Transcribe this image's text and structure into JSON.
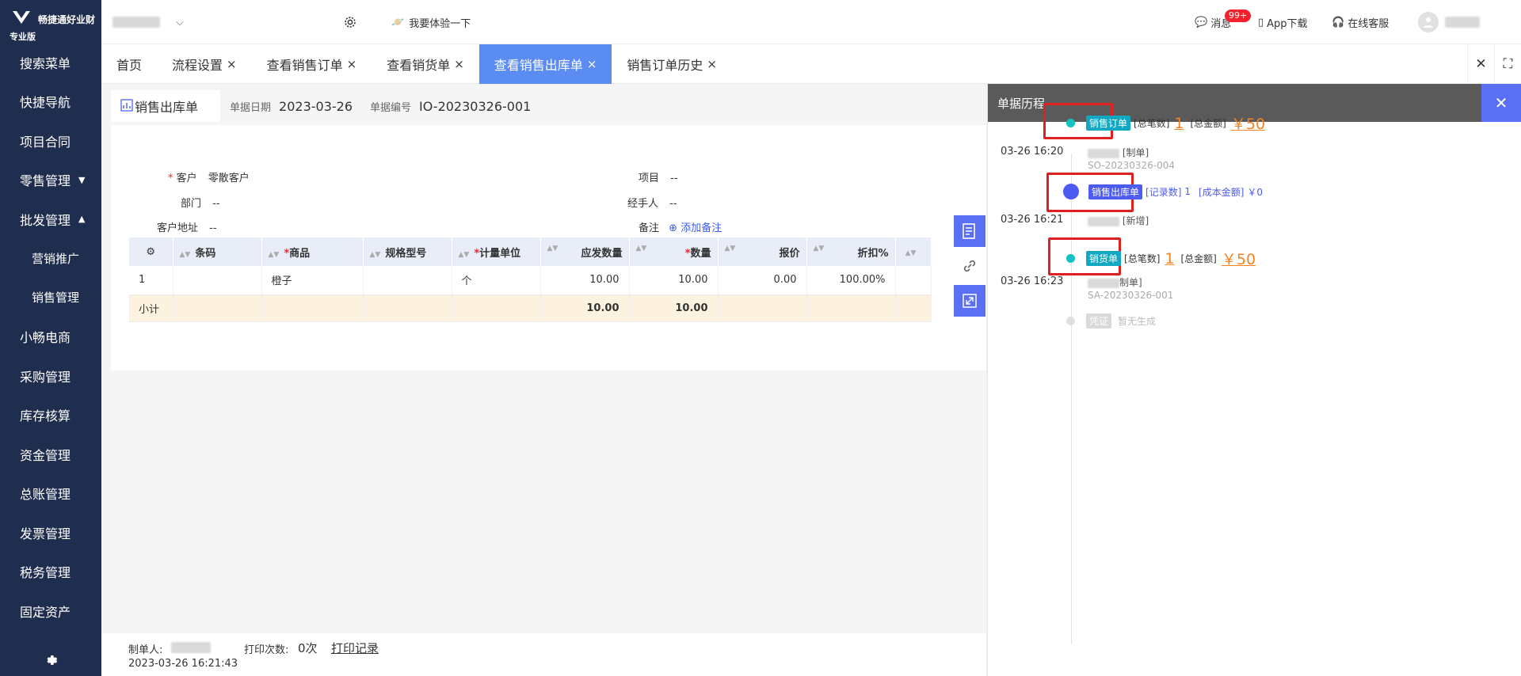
{
  "brand": {
    "name": "畅捷通好业财",
    "edition": "专业版"
  },
  "sidebar": {
    "items": [
      {
        "label": "搜索菜单",
        "sub": false,
        "caret": ""
      },
      {
        "label": "快捷导航",
        "sub": false,
        "caret": ""
      },
      {
        "label": "项目合同",
        "sub": false,
        "caret": ""
      },
      {
        "label": "零售管理",
        "sub": false,
        "caret": "▼"
      },
      {
        "label": "批发管理",
        "sub": false,
        "caret": "▲"
      },
      {
        "label": "营销推广",
        "sub": true,
        "caret": ""
      },
      {
        "label": "销售管理",
        "sub": true,
        "caret": ""
      },
      {
        "label": "小畅电商",
        "sub": false,
        "caret": ""
      },
      {
        "label": "采购管理",
        "sub": false,
        "caret": ""
      },
      {
        "label": "库存核算",
        "sub": false,
        "caret": ""
      },
      {
        "label": "资金管理",
        "sub": false,
        "caret": ""
      },
      {
        "label": "总账管理",
        "sub": false,
        "caret": ""
      },
      {
        "label": "发票管理",
        "sub": false,
        "caret": ""
      },
      {
        "label": "税务管理",
        "sub": false,
        "caret": ""
      },
      {
        "label": "固定资产",
        "sub": false,
        "caret": ""
      }
    ]
  },
  "topbar": {
    "try_label": "我要体验一下",
    "messages_label": "消息",
    "messages_badge": "99+",
    "app_label": "App下载",
    "service_label": "在线客服"
  },
  "tabs": [
    {
      "label": "首页",
      "closable": false,
      "active": false
    },
    {
      "label": "流程设置",
      "closable": true,
      "active": false
    },
    {
      "label": "查看销售订单",
      "closable": true,
      "active": false
    },
    {
      "label": "查看销货单",
      "closable": true,
      "active": false
    },
    {
      "label": "查看销售出库单",
      "closable": true,
      "active": true
    },
    {
      "label": "销售订单历史",
      "closable": true,
      "active": false
    }
  ],
  "doc": {
    "tab_label": "销售出库单",
    "date_label": "单据日期",
    "date_value": "2023-03-26",
    "no_label": "单据编号",
    "no_value": "IO-20230326-001"
  },
  "form": {
    "customer_label": "客户",
    "customer_value": "零散客户",
    "dept_label": "部门",
    "dept_value": "--",
    "address_label": "客户地址",
    "address_value": "--",
    "project_label": "项目",
    "project_value": "--",
    "handler_label": "经手人",
    "handler_value": "--",
    "remark_label": "备注",
    "remark_add": "添加备注"
  },
  "table": {
    "headers": [
      "条码",
      "商品",
      "规格型号",
      "计量单位",
      "应发数量",
      "数量",
      "报价",
      "折扣%"
    ],
    "rows": [
      {
        "idx": "1",
        "barcode": "",
        "product": "橙子",
        "spec": "",
        "unit": "个",
        "due_qty": "10.00",
        "qty": "10.00",
        "price": "0.00",
        "discount": "100.00%"
      }
    ],
    "subtotal": {
      "label": "小计",
      "due_qty": "10.00",
      "qty": "10.00"
    }
  },
  "footer": {
    "maker_label": "制单人:",
    "maker_time": "2023-03-26 16:21:43",
    "print_label": "打印次数:",
    "print_count": "0次",
    "print_record": "打印记录"
  },
  "history": {
    "title": "单据历程",
    "nodes": [
      {
        "tag": "销售订单",
        "k1": "[总笔数]",
        "v1": "1",
        "k2": "[总金额]",
        "v2": "￥50",
        "time": "03-26 16:20",
        "action": "[制单]",
        "code": "SO-20230326-004"
      },
      {
        "tag": "销售出库单",
        "k1": "[记录数]",
        "v1": "1",
        "k2": "[成本金额]",
        "v2": "￥0",
        "time": "03-26 16:21",
        "action": "[新增]",
        "code": ""
      },
      {
        "tag": "销货单",
        "k1": "[总笔数]",
        "v1": "1",
        "k2": "[总金额]",
        "v2": "￥50",
        "time": "03-26 16:23",
        "action": "制单]",
        "code": "SA-20230326-001"
      },
      {
        "tag": "凭证",
        "k1": "暂无生成"
      }
    ]
  },
  "colors": {
    "sidebar": "#1f2d4e",
    "accent": "#5b8cf2",
    "panel_accent": "#5b6ff5",
    "highlight": "#e02020",
    "amount": "#f58220"
  }
}
